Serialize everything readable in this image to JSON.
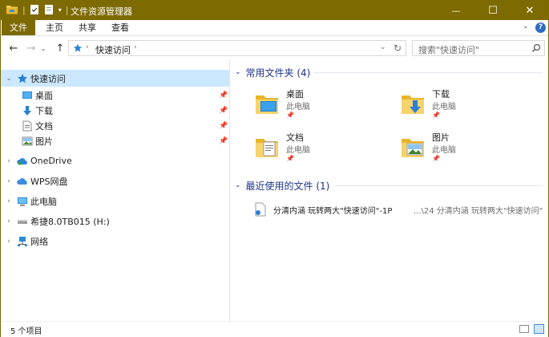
{
  "window": {
    "title": "文件资源管理器",
    "accent": "#7d6a00",
    "min_glyph": "—",
    "max_glyph": "☐",
    "close_glyph": "✕"
  },
  "ribbon": {
    "tabs": [
      "文件",
      "主页",
      "共享",
      "查看"
    ],
    "help_glyph": "?"
  },
  "address": {
    "path": "快速访问",
    "search_placeholder": "搜索\"快速访问\""
  },
  "nav": {
    "quick_access": "快速访问",
    "pinned": [
      {
        "label": "桌面",
        "icon": "desktop-icon"
      },
      {
        "label": "下载",
        "icon": "download-icon"
      },
      {
        "label": "文档",
        "icon": "document-icon"
      },
      {
        "label": "图片",
        "icon": "picture-icon"
      }
    ],
    "roots": [
      {
        "label": "OneDrive",
        "icon": "onedrive-icon"
      },
      {
        "label": "WPS网盘",
        "icon": "wps-cloud-icon"
      },
      {
        "label": "此电脑",
        "icon": "computer-icon"
      },
      {
        "label": "希捷8.0TB015 (H:)",
        "icon": "drive-icon"
      },
      {
        "label": "网络",
        "icon": "network-icon"
      }
    ]
  },
  "frequent": {
    "header": "常用文件夹 (4)",
    "items": [
      {
        "name": "桌面",
        "location": "此电脑"
      },
      {
        "name": "下载",
        "location": "此电脑"
      },
      {
        "name": "文档",
        "location": "此电脑"
      },
      {
        "name": "图片",
        "location": "此电脑"
      }
    ]
  },
  "recent": {
    "header": "最近使用的文件 (1)",
    "items": [
      {
        "name": "分清内涵  玩转两大\"快速访问\"-1P",
        "path": "...\\24 分清内涵  玩转两大\"快速访问\""
      }
    ]
  },
  "status": {
    "count": "5 个项目"
  }
}
